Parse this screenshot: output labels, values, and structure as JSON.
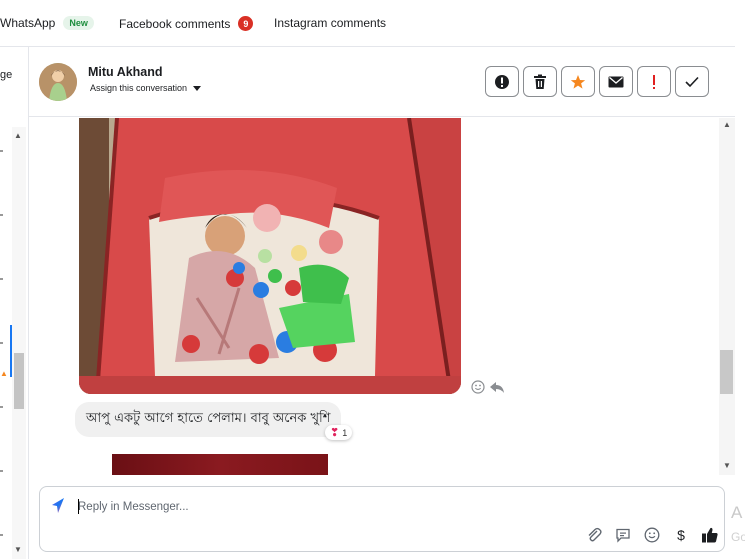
{
  "tabs": [
    {
      "label": "WhatsApp",
      "badge": "New"
    },
    {
      "label": "Facebook comments",
      "count": "9"
    },
    {
      "label": "Instagram comments"
    }
  ],
  "left_partial_text": "ge",
  "conversation": {
    "contact_name": "Mitu Akhand",
    "assign_label": "Assign this conversation"
  },
  "header_actions": [
    "spam-icon",
    "delete-icon",
    "star-icon",
    "mail-icon",
    "important-icon",
    "done-icon"
  ],
  "messages": {
    "photo_alt": "Child playing in a red tent with colorful balls",
    "text": "আপু একটু আগে হাতে পেলাম। বাবু অনেক খুশি",
    "reaction": {
      "emoji": "❣",
      "count": "1"
    }
  },
  "reply": {
    "placeholder": "Reply in Messenger..."
  },
  "background_text": {
    "line1": "A",
    "line2": "Go"
  },
  "colors": {
    "accent": "#1877f2",
    "star": "#f5871f",
    "important": "#e02020",
    "badge_new_bg": "#e6f4ea",
    "badge_new_fg": "#1e8e3e",
    "count_badge": "#d93025"
  }
}
